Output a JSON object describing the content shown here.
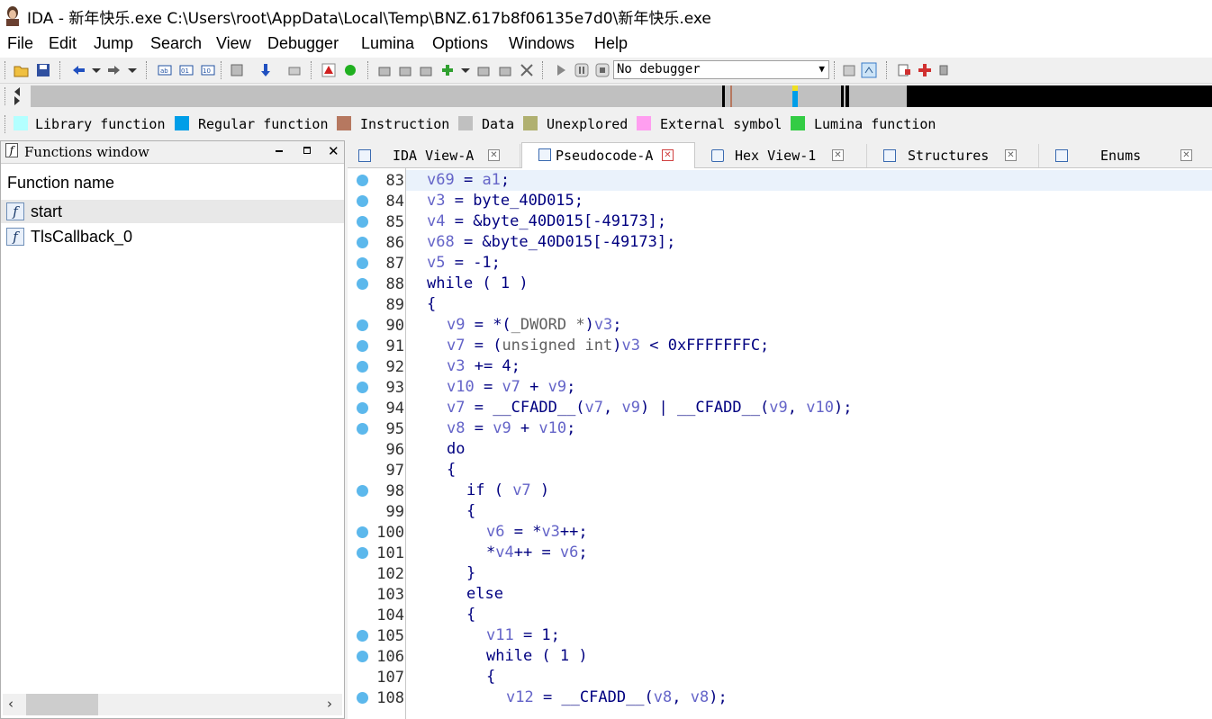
{
  "window": {
    "title": "IDA - 新年快乐.exe C:\\Users\\root\\AppData\\Local\\Temp\\BNZ.617b8f06135e7d0\\新年快乐.exe"
  },
  "menu": [
    "File",
    "Edit",
    "Jump",
    "Search",
    "View",
    "Debugger",
    "Lumina",
    "Options",
    "Windows",
    "Help"
  ],
  "toolbar": {
    "debugger_select": "No debugger",
    "icons": [
      "open-icon",
      "save-icon",
      "back-icon",
      "back-dropdown-icon",
      "forward-icon",
      "forward-dropdown-icon",
      "search-text-icon",
      "search-seq-icon",
      "search-imm-icon",
      "hex-icon",
      "down-arrow-icon",
      "names-icon",
      "warning-icon",
      "green-dot-icon",
      "code-icon",
      "data-icon",
      "string-icon",
      "plus-icon",
      "undef-icon",
      "patch-icon",
      "close-x-icon",
      "run-icon",
      "pause-icon",
      "stop-icon",
      "callstack-icon",
      "graph-icon",
      "lumina-pull-icon",
      "lumina-push-icon",
      "settings-icon"
    ]
  },
  "legend": [
    {
      "label": "Library function",
      "color": "#b3ffff"
    },
    {
      "label": "Regular function",
      "color": "#009ee8"
    },
    {
      "label": "Instruction",
      "color": "#b67860"
    },
    {
      "label": "Data",
      "color": "#c0c0c0"
    },
    {
      "label": "Unexplored",
      "color": "#b0b070"
    },
    {
      "label": "External symbol",
      "color": "#ff9ef0"
    },
    {
      "label": "Lumina function",
      "color": "#33cc44"
    }
  ],
  "functions_window": {
    "title": "Functions window",
    "column": "Function name",
    "items": [
      "start",
      "TlsCallback_0"
    ]
  },
  "tabs": [
    {
      "label": "IDA View-A",
      "active": false
    },
    {
      "label": "Pseudocode-A",
      "active": true
    },
    {
      "label": "Hex View-1",
      "active": false
    },
    {
      "label": "Structures",
      "active": false
    },
    {
      "label": "Enums",
      "active": false
    }
  ],
  "code_lines": [
    {
      "num": "83",
      "dot": true,
      "indent": 0,
      "html": "<span class='var'>v69</span> = <span class='var'>a1</span>;"
    },
    {
      "num": "84",
      "dot": true,
      "indent": 0,
      "html": "<span class='var'>v3</span> = byte_40D015;"
    },
    {
      "num": "85",
      "dot": true,
      "indent": 0,
      "html": "<span class='var'>v4</span> = &amp;byte_40D015[-49173];"
    },
    {
      "num": "86",
      "dot": true,
      "indent": 0,
      "html": "<span class='var'>v68</span> = &amp;byte_40D015[-49173];"
    },
    {
      "num": "87",
      "dot": true,
      "indent": 0,
      "html": "<span class='var'>v5</span> = -1;"
    },
    {
      "num": "88",
      "dot": true,
      "indent": 0,
      "html": "while ( 1 )"
    },
    {
      "num": "89",
      "dot": false,
      "indent": 0,
      "html": "{"
    },
    {
      "num": "90",
      "dot": true,
      "indent": 1,
      "html": "<span class='var'>v9</span> = *(<span class='gray'>_DWORD *</span>)<span class='var'>v3</span>;"
    },
    {
      "num": "91",
      "dot": true,
      "indent": 1,
      "html": "<span class='var'>v7</span> = (<span class='gray'>unsigned int</span>)<span class='var'>v3</span> &lt; 0xFFFFFFFC;"
    },
    {
      "num": "92",
      "dot": true,
      "indent": 1,
      "html": "<span class='var'>v3</span> += 4;"
    },
    {
      "num": "93",
      "dot": true,
      "indent": 1,
      "html": "<span class='var'>v10</span> = <span class='var'>v7</span> + <span class='var'>v9</span>;"
    },
    {
      "num": "94",
      "dot": true,
      "indent": 1,
      "html": "<span class='var'>v7</span> = __CFADD__(<span class='var'>v7</span>, <span class='var'>v9</span>) | __CFADD__(<span class='var'>v9</span>, <span class='var'>v10</span>);"
    },
    {
      "num": "95",
      "dot": true,
      "indent": 1,
      "html": "<span class='var'>v8</span> = <span class='var'>v9</span> + <span class='var'>v10</span>;"
    },
    {
      "num": "96",
      "dot": false,
      "indent": 1,
      "html": "do"
    },
    {
      "num": "97",
      "dot": false,
      "indent": 1,
      "html": "{"
    },
    {
      "num": "98",
      "dot": true,
      "indent": 2,
      "html": "if ( <span class='var'>v7</span> )"
    },
    {
      "num": "99",
      "dot": false,
      "indent": 2,
      "html": "{"
    },
    {
      "num": "100",
      "dot": true,
      "indent": 3,
      "html": "<span class='var'>v6</span> = *<span class='var'>v3</span>++;"
    },
    {
      "num": "101",
      "dot": true,
      "indent": 3,
      "html": "*<span class='var'>v4</span>++ = <span class='var'>v6</span>;"
    },
    {
      "num": "102",
      "dot": false,
      "indent": 2,
      "html": "}"
    },
    {
      "num": "103",
      "dot": false,
      "indent": 2,
      "html": "else"
    },
    {
      "num": "104",
      "dot": false,
      "indent": 2,
      "html": "{"
    },
    {
      "num": "105",
      "dot": true,
      "indent": 3,
      "html": "<span class='var'>v11</span> = 1;"
    },
    {
      "num": "106",
      "dot": true,
      "indent": 3,
      "html": "while ( 1 )"
    },
    {
      "num": "107",
      "dot": false,
      "indent": 3,
      "html": "{"
    },
    {
      "num": "108",
      "dot": true,
      "indent": 4,
      "html": "<span class='var'>v12</span> = __CFADD__(<span class='var'>v8</span>, <span class='var'>v8</span>);"
    }
  ]
}
